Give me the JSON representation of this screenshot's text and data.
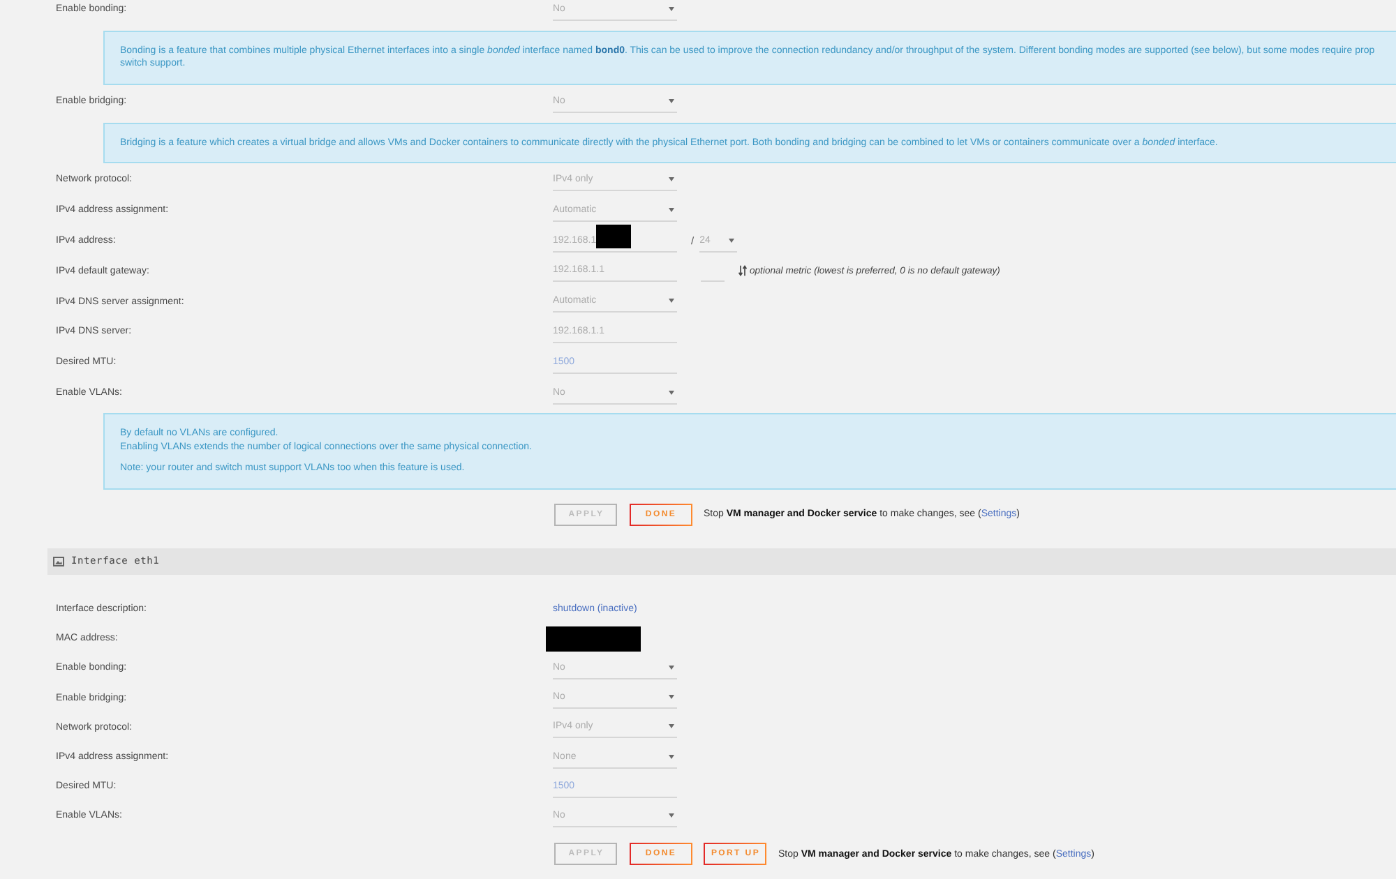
{
  "interfaces": [
    {
      "rows": [
        {
          "kind": "select",
          "label": "Enable bonding:",
          "value": "No",
          "disabled": true
        },
        {
          "kind": "info",
          "paragraphs": [
            [
              "Bonding is a feature that combines multiple physical Ethernet interfaces into a single *bonded* interface named **bond0**. This can be used to improve the connection redundancy and/or throughput of the system. Different bonding modes are supported (see below), but some modes require prop",
              "switch support."
            ]
          ]
        },
        {
          "kind": "select",
          "label": "Enable bridging:",
          "value": "No",
          "disabled": true
        },
        {
          "kind": "info",
          "paragraphs": [
            [
              "Bridging is a feature which creates a virtual bridge and allows VMs and Docker containers to communicate directly with the physical Ethernet port. Both bonding and bridging can be combined to let VMs or containers communicate over a *bonded* interface."
            ]
          ]
        },
        {
          "kind": "select",
          "label": "Network protocol:",
          "value": "IPv4 only",
          "disabled": true
        },
        {
          "kind": "select",
          "label": "IPv4 address assignment:",
          "value": "Automatic",
          "disabled": true
        },
        {
          "kind": "input",
          "label": "IPv4 address:",
          "value": "192.168.1",
          "disabled": true,
          "redacted": true,
          "prefix": {
            "separator": "/",
            "value": "24",
            "disabled": true
          }
        },
        {
          "kind": "input",
          "label": "IPv4 default gateway:",
          "value": "192.168.1.1",
          "disabled": true,
          "metric": {
            "note": "optional metric (lowest is preferred, 0 is no default gateway)"
          }
        },
        {
          "kind": "select",
          "label": "IPv4 DNS server assignment:",
          "value": "Automatic",
          "disabled": true
        },
        {
          "kind": "input",
          "label": "IPv4 DNS server:",
          "value": "192.168.1.1",
          "disabled": true
        },
        {
          "kind": "input",
          "label": "Desired MTU:",
          "placeholder": "1500",
          "disabled": true
        },
        {
          "kind": "select",
          "label": "Enable VLANs:",
          "value": "No",
          "disabled": true
        },
        {
          "kind": "info",
          "paragraphs": [
            [
              "By default no VLANs are configured.",
              "Enabling VLANs extends the number of logical connections over the same physical connection."
            ],
            [
              "Note: your router and switch must support VLANs too when this feature is used."
            ]
          ]
        },
        {
          "kind": "actions",
          "buttons": [
            {
              "label": "APPLY",
              "disabled": true
            },
            {
              "label": "DONE",
              "disabled": false
            }
          ],
          "note": {
            "text": "Stop **VM manager and Docker service** to make changes, see (",
            "link": "Settings",
            "after": ")"
          }
        }
      ]
    },
    {
      "header": {
        "title": "Interface eth1"
      },
      "rows": [
        {
          "kind": "link",
          "label": "Interface description:",
          "value": "shutdown (inactive)"
        },
        {
          "kind": "redacted",
          "label": "MAC address:"
        },
        {
          "kind": "select",
          "label": "Enable bonding:",
          "value": "No",
          "disabled": true
        },
        {
          "kind": "select",
          "label": "Enable bridging:",
          "value": "No",
          "disabled": true
        },
        {
          "kind": "select",
          "label": "Network protocol:",
          "value": "IPv4 only",
          "disabled": true
        },
        {
          "kind": "select",
          "label": "IPv4 address assignment:",
          "value": "None",
          "disabled": true
        },
        {
          "kind": "input",
          "label": "Desired MTU:",
          "placeholder": "1500",
          "disabled": true
        },
        {
          "kind": "select",
          "label": "Enable VLANs:",
          "value": "No",
          "disabled": true
        },
        {
          "kind": "actions",
          "buttons": [
            {
              "label": "APPLY",
              "disabled": true
            },
            {
              "label": "DONE",
              "disabled": false
            },
            {
              "label": "PORT UP",
              "disabled": false
            }
          ],
          "note": {
            "text": "Stop **VM manager and Docker service** to make changes, see (",
            "link": "Settings",
            "after": ")"
          }
        }
      ]
    }
  ]
}
